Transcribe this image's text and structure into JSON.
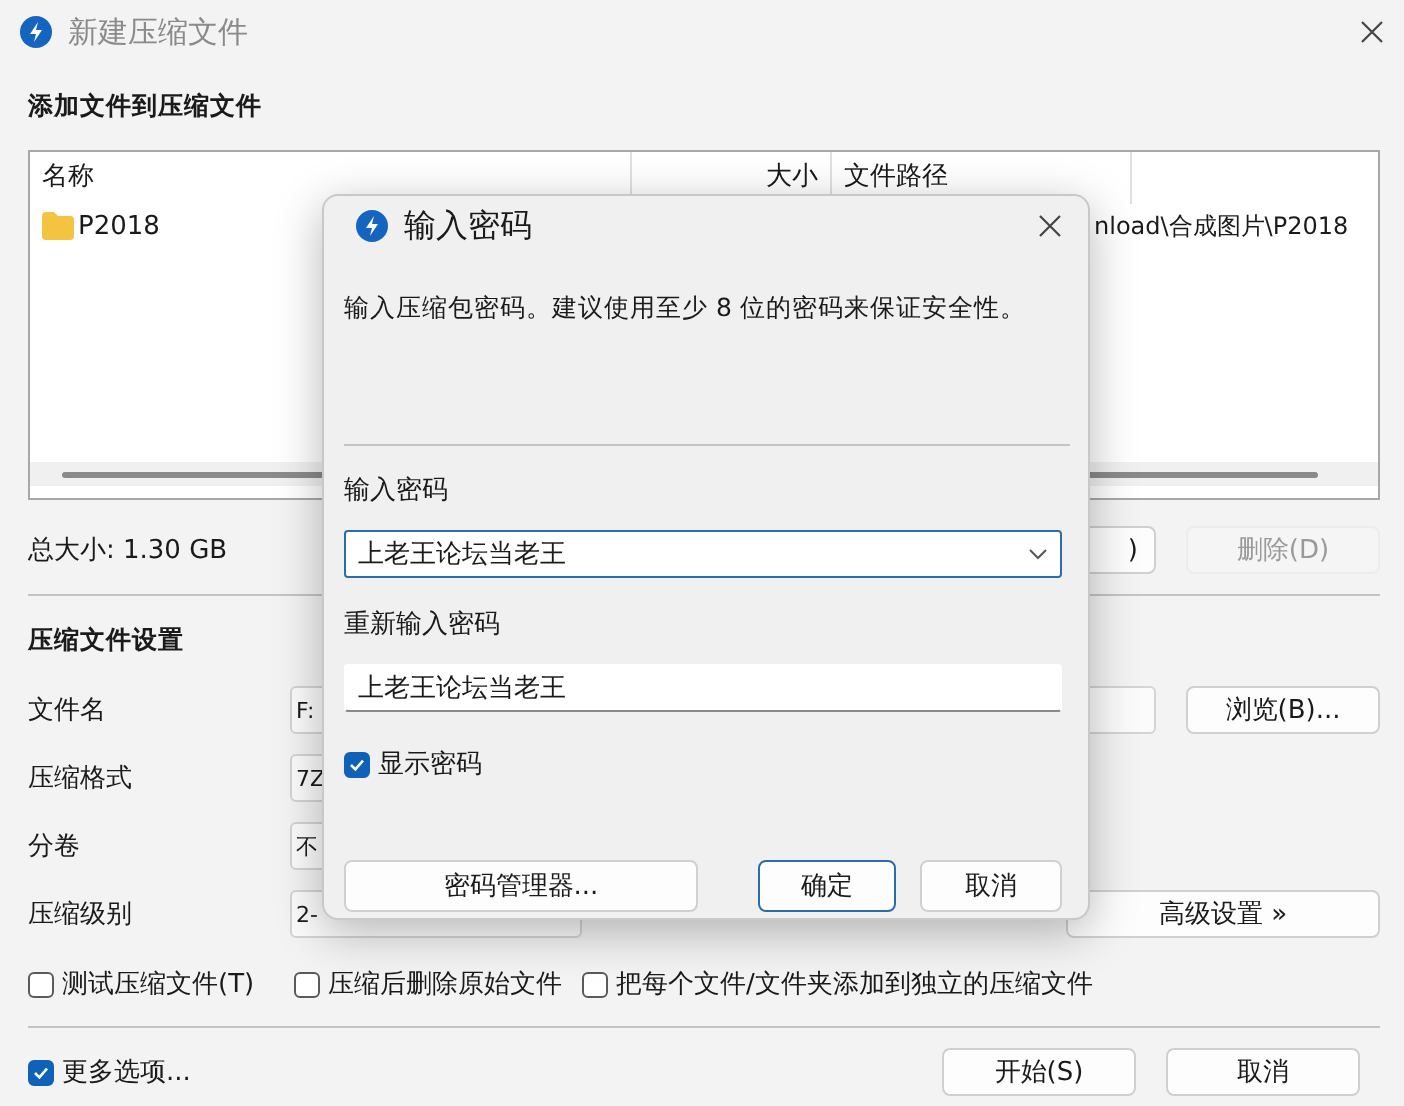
{
  "window": {
    "title": "新建压缩文件"
  },
  "section_title": "添加文件到压缩文件",
  "file_list": {
    "columns": [
      "名称",
      "大小",
      "文件路径"
    ],
    "rows": [
      {
        "name": "P2018",
        "path": "nload\\合成图片\\P2018"
      }
    ]
  },
  "total_size": "总大小: 1.30 GB",
  "list_buttons": [
    {
      "label": ")",
      "disabled": false
    },
    {
      "label": "删除(D)",
      "disabled": true
    }
  ],
  "settings_title": "压缩文件设置",
  "settings": [
    {
      "label": "文件名",
      "kind": "path",
      "value": "F:",
      "button": "浏览(B)..."
    },
    {
      "label": "压缩格式",
      "kind": "select",
      "value": "7Z"
    },
    {
      "label": "分卷",
      "kind": "select",
      "value": "不"
    },
    {
      "label": "压缩级别",
      "kind": "select",
      "value": "2-",
      "button": "高级设置 »"
    }
  ],
  "options": [
    {
      "label": "测试压缩文件(T)",
      "checked": false
    },
    {
      "label": "压缩后删除原始文件",
      "checked": false
    },
    {
      "label": "把每个文件/文件夹添加到独立的压缩文件",
      "checked": false
    }
  ],
  "more_options": {
    "label": "更多选项...",
    "checked": true
  },
  "footer_buttons": [
    "开始(S)",
    "取消"
  ],
  "password_dialog": {
    "title": "输入密码",
    "description": "输入压缩包密码。建议使用至少 8 位的密码来保证安全性。",
    "password_label": "输入密码",
    "password": "上老王论坛当老王",
    "confirm_label": "重新输入密码",
    "confirm": "上老王论坛当老王",
    "show_password": {
      "label": "显示密码",
      "checked": true
    },
    "buttons": [
      {
        "label": "密码管理器...",
        "default": false
      },
      {
        "label": "确定",
        "default": true
      },
      {
        "label": "取消",
        "default": false
      }
    ]
  }
}
